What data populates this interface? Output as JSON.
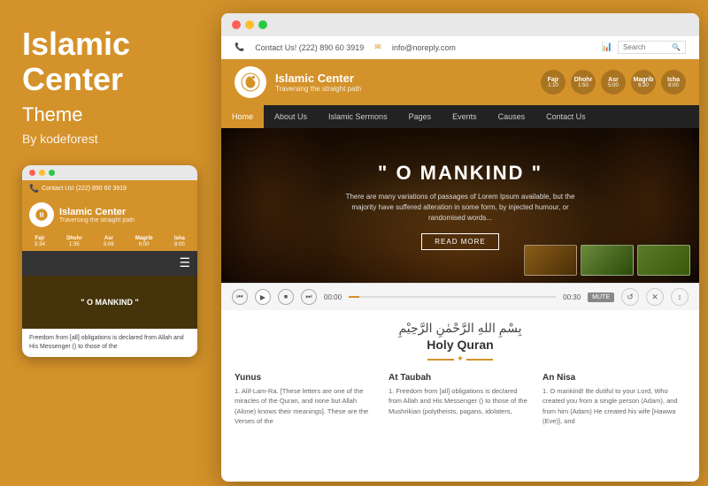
{
  "left": {
    "title": "Islamic\nCenter",
    "subtitle": "Theme",
    "by": "By kodeforest"
  },
  "mobile": {
    "topbar": "Contact Us! (222) 890 60 3919",
    "header_title": "Islamic Center",
    "header_tagline": "Traversing the straight path",
    "prayer_times": [
      {
        "name": "Fajr",
        "time": "5:34"
      },
      {
        "name": "Dhuhr",
        "time": "1:35"
      },
      {
        "name": "Asr",
        "time": "5:06"
      },
      {
        "name": "Magrib",
        "time": "6:00"
      },
      {
        "name": "Isha",
        "time": "8:00"
      }
    ],
    "hero_quote": "\" O MANKIND \"",
    "content_text": "Freedom from [all] obligations is declared from Allah and His Messenger () to those of the"
  },
  "browser": {
    "topbar": {
      "contact": "Contact Us! (222) 890 60 3919",
      "email": "info@noreply.com",
      "search_placeholder": "Search"
    },
    "header": {
      "site_name": "Islamic Center",
      "tagline": "Traversing the straight path",
      "prayer_times": [
        {
          "name": "Fajr",
          "time": "1:10"
        },
        {
          "name": "Dhohr",
          "time": "1:50"
        },
        {
          "name": "Asr",
          "time": "5:00"
        },
        {
          "name": "Magrib",
          "time": "6:30"
        },
        {
          "name": "Isha",
          "time": "8:00"
        }
      ]
    },
    "nav": {
      "items": [
        {
          "label": "Home",
          "active": true
        },
        {
          "label": "About Us",
          "active": false
        },
        {
          "label": "Islamic Sermons",
          "active": false
        },
        {
          "label": "Pages",
          "active": false
        },
        {
          "label": "Events",
          "active": false
        },
        {
          "label": "Causes",
          "active": false
        },
        {
          "label": "Contact Us",
          "active": false
        }
      ]
    },
    "hero": {
      "quote": "\" O MANKIND \"",
      "description": "There are many variations of passages of Lorem Ipsum available, but the majority have suffered alteration in some form, by injected humour, or randomised words...",
      "button_label": "READ MORE"
    },
    "player": {
      "time_start": "00:00",
      "time_end": "00:30",
      "mute_label": "MUTE"
    },
    "main": {
      "arabic_text": "بِسْمِ اللهِ الرَّحْمٰنِ الرَّحِيْمِ",
      "title": "Holy Quran",
      "columns": [
        {
          "title": "Yunus",
          "text": "1. Alif-Lam-Ra. [These letters are one of the miracles of the Quran, and none but Allah (Alone) knows their meanings]. These are the Verses of the"
        },
        {
          "title": "At Taubah",
          "text": "1. Freedom from [all] obligations is declared from Allah and His Messenger () to those of the Mushrikian (polytheists, pagans, idolaters,"
        },
        {
          "title": "An Nisa",
          "text": "1. O mankind! Be dutiful to your Lord, Who created you from a single person (Adam), and from him (Adam) He created his wife [Hawwa (Eve)], and"
        }
      ]
    }
  }
}
